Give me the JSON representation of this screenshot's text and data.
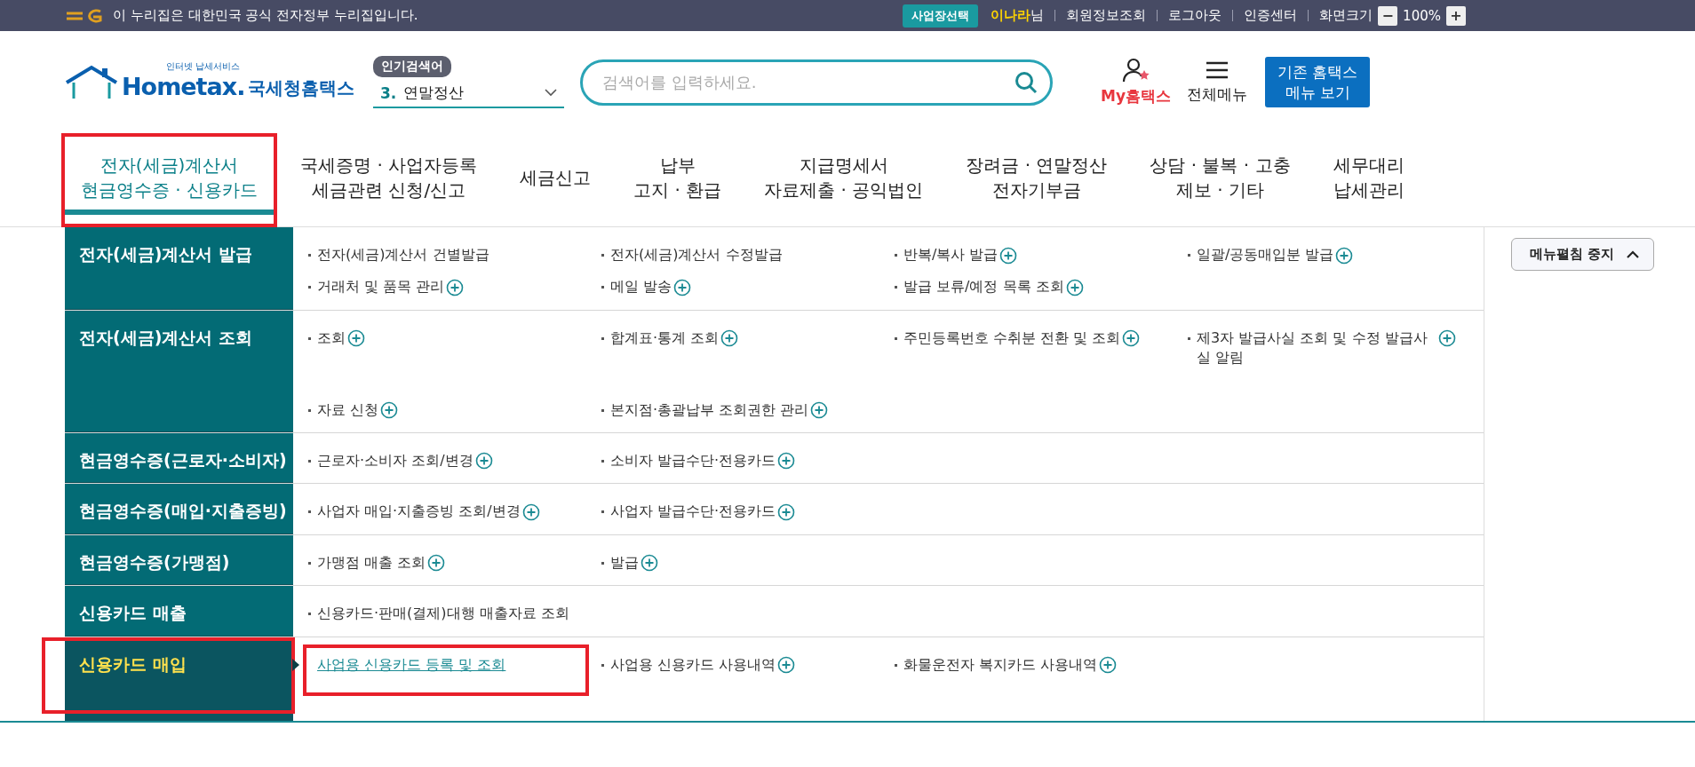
{
  "top_bar": {
    "notice": "이 누리집은 대한민국 공식 전자정부 누리집입니다.",
    "workplace_button": "사업장선택",
    "user_name": "이나라",
    "user_suffix": "님",
    "links": [
      "회원정보조회",
      "로그아웃",
      "인증센터"
    ],
    "zoom_label": "화면크기",
    "zoom_out": "−",
    "zoom_value": "100%",
    "zoom_in": "+"
  },
  "header": {
    "logo": {
      "tagline": "인터넷 납세서비스",
      "wordmark": "Hometax.",
      "name": "국세청홈택스"
    },
    "popular_badge": "인기검색어",
    "popular_rank": "3.",
    "popular_term": "연말정산",
    "search": {
      "placeholder": "검색어를 입력하세요."
    },
    "my_label": "My홈택스",
    "all_menu_label": "전체메뉴",
    "legacy_button": [
      "기존 홈택스",
      "메뉴 보기"
    ]
  },
  "nav": [
    {
      "lines": [
        "전자(세금)계산서",
        "현금영수증 · 신용카드"
      ],
      "selected": true,
      "annotated": true
    },
    {
      "lines": [
        "국세증명 · 사업자등록",
        "세금관련 신청/신고"
      ],
      "selected": false,
      "annotated": false
    },
    {
      "lines": [
        "세금신고"
      ],
      "selected": false,
      "annotated": false
    },
    {
      "lines": [
        "납부",
        "고지 · 환급"
      ],
      "selected": false,
      "annotated": false
    },
    {
      "lines": [
        "지급명세서",
        "자료제출 · 공익법인"
      ],
      "selected": false,
      "annotated": false
    },
    {
      "lines": [
        "장려금 · 연말정산",
        "전자기부금"
      ],
      "selected": false,
      "annotated": false
    },
    {
      "lines": [
        "상담 · 불복 · 고충",
        "제보 · 기타"
      ],
      "selected": false,
      "annotated": false
    },
    {
      "lines": [
        "세무대리",
        "납세관리"
      ],
      "selected": false,
      "annotated": false
    }
  ],
  "menu": [
    {
      "title": "전자(세금)계산서 발급",
      "selected": false,
      "annotated": false,
      "items": [
        {
          "label": "전자(세금)계산서 건별발급",
          "plus": false,
          "selected": false,
          "annotated": false
        },
        {
          "label": "전자(세금)계산서 수정발급",
          "plus": false,
          "selected": false,
          "annotated": false
        },
        {
          "label": "반복/복사 발급",
          "plus": true,
          "selected": false,
          "annotated": false
        },
        {
          "label": "일괄/공동매입분 발급",
          "plus": true,
          "selected": false,
          "annotated": false
        },
        {
          "label": "거래처 및 품목 관리",
          "plus": true,
          "selected": false,
          "annotated": false
        },
        {
          "label": "메일 발송",
          "plus": true,
          "selected": false,
          "annotated": false
        },
        {
          "label": "발급 보류/예정 목록 조회",
          "plus": true,
          "selected": false,
          "annotated": false
        }
      ]
    },
    {
      "title": "전자(세금)계산서 조회",
      "selected": false,
      "annotated": false,
      "items": [
        {
          "label": "조회",
          "plus": true,
          "selected": false,
          "annotated": false
        },
        {
          "label": "합계표·통계 조회",
          "plus": true,
          "selected": false,
          "annotated": false
        },
        {
          "label": "주민등록번호 수취분 전환 및 조회",
          "plus": true,
          "selected": false,
          "annotated": false
        },
        {
          "label": "제3자 발급사실 조회 및 수정 발급사실 알림",
          "plus": true,
          "selected": false,
          "annotated": false
        },
        {
          "label": "자료 신청",
          "plus": true,
          "selected": false,
          "annotated": false
        },
        {
          "label": "본지점·총괄납부 조회권한 관리",
          "plus": true,
          "selected": false,
          "annotated": false
        }
      ]
    },
    {
      "title": "현금영수증(근로자·소비자)",
      "selected": false,
      "annotated": false,
      "items": [
        {
          "label": "근로자·소비자 조회/변경",
          "plus": true,
          "selected": false,
          "annotated": false
        },
        {
          "label": "소비자 발급수단·전용카드",
          "plus": true,
          "selected": false,
          "annotated": false
        }
      ]
    },
    {
      "title": "현금영수증(매입·지출증빙)",
      "selected": false,
      "annotated": false,
      "items": [
        {
          "label": "사업자 매입·지출증빙 조회/변경",
          "plus": true,
          "selected": false,
          "annotated": false
        },
        {
          "label": "사업자 발급수단·전용카드",
          "plus": true,
          "selected": false,
          "annotated": false
        }
      ]
    },
    {
      "title": "현금영수증(가맹점)",
      "selected": false,
      "annotated": false,
      "items": [
        {
          "label": "가맹점 매출 조회",
          "plus": true,
          "selected": false,
          "annotated": false
        },
        {
          "label": "발급",
          "plus": true,
          "selected": false,
          "annotated": false
        }
      ]
    },
    {
      "title": "신용카드 매출",
      "selected": false,
      "annotated": false,
      "items": [
        {
          "label": "신용카드·판매(결제)대행 매출자료 조회",
          "plus": false,
          "selected": false,
          "annotated": false
        }
      ]
    },
    {
      "title": "신용카드 매입",
      "selected": true,
      "annotated": true,
      "items": [
        {
          "label": "사업용 신용카드 등록 및 조회",
          "plus": false,
          "selected": true,
          "annotated": true
        },
        {
          "label": "사업용 신용카드 사용내역",
          "plus": true,
          "selected": false,
          "annotated": false
        },
        {
          "label": "화물운전자 복지카드 사용내역",
          "plus": true,
          "selected": false,
          "annotated": false
        }
      ]
    }
  ],
  "collapse_button": "메뉴펼침 중지"
}
